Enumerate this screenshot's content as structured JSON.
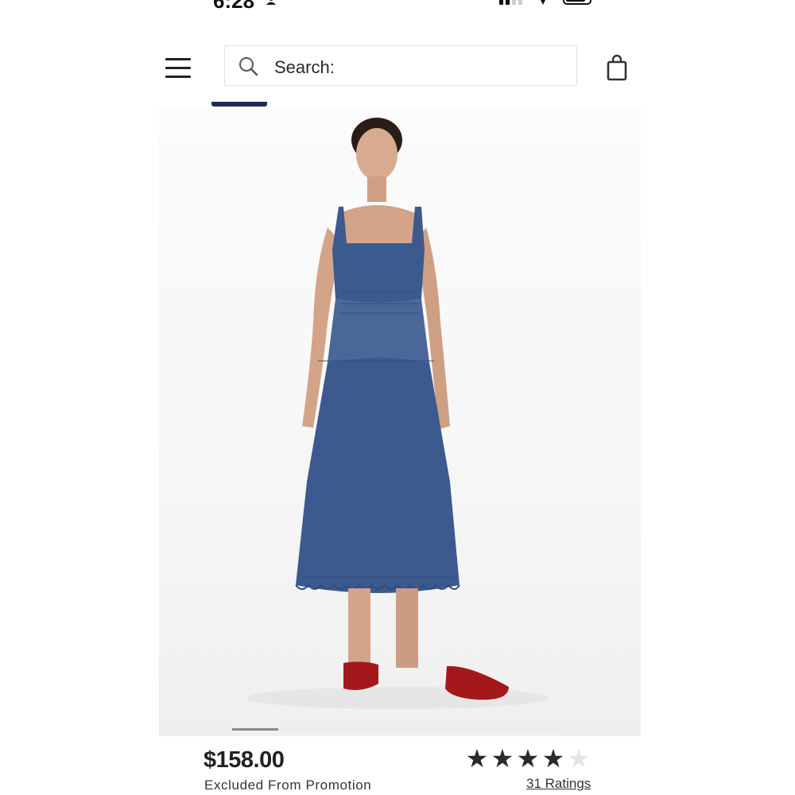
{
  "status_bar": {
    "time": "6:28"
  },
  "header": {
    "search_placeholder": "Search:",
    "icons": {
      "menu": "hamburger-menu-icon",
      "search": "search-icon",
      "bag": "shopping-bag-icon"
    }
  },
  "product": {
    "image": "navy-eyelet-midi-dress-model-photo",
    "colors": {
      "dress": "#3c5a8e",
      "shoes": "#a4181c"
    },
    "carousel": {
      "current": 1
    },
    "price": "$158.00",
    "promotion_note": "Excluded From Promotion",
    "rating": {
      "stars_filled": 4,
      "stars_total": 5,
      "count_label": "31 Ratings"
    }
  },
  "colors": {
    "accent_indicator": "#1f2a5c",
    "star_filled": "#2a2a2a",
    "star_empty": "#e4e4e4"
  }
}
